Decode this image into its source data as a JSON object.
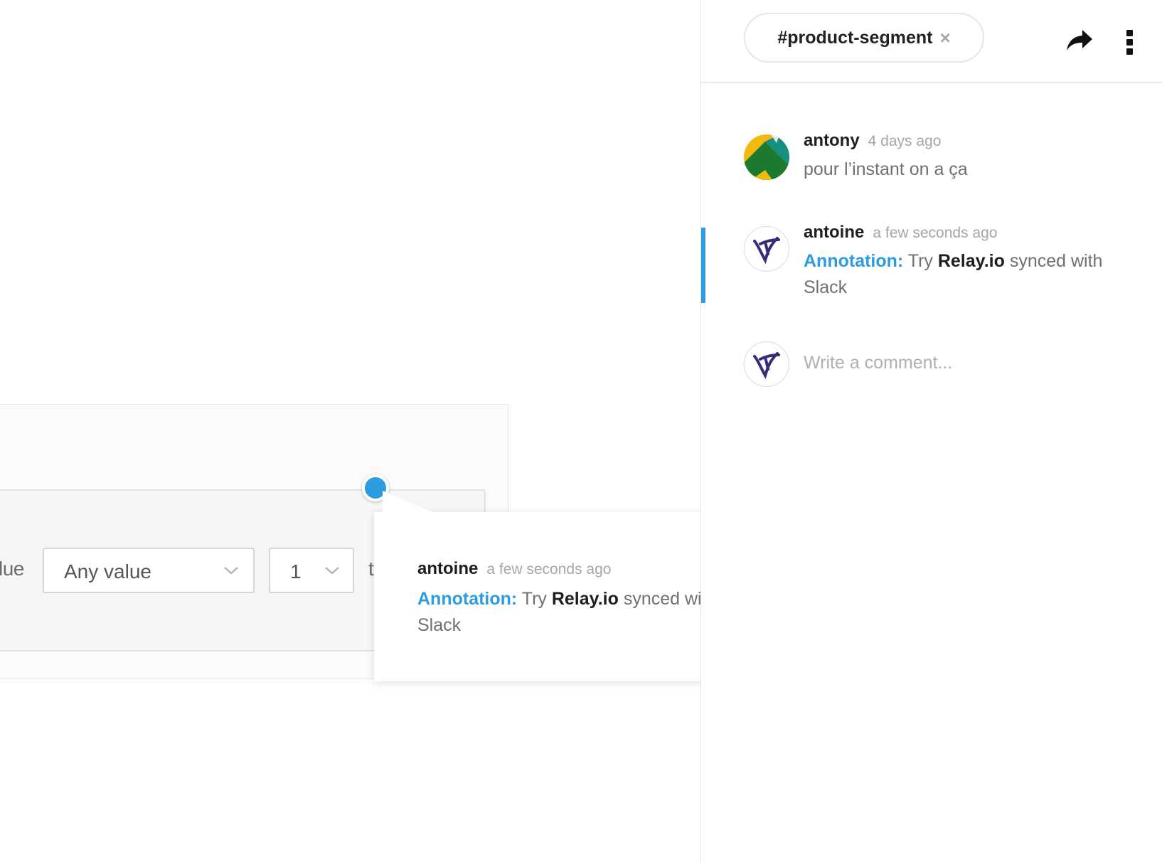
{
  "canvas": {
    "row_label": "lue",
    "select_any": {
      "value": "Any value"
    },
    "select_one": {
      "value": "1"
    },
    "row_trail": "t"
  },
  "popover": {
    "author": "antoine",
    "time": "a few seconds ago",
    "annotation_label": "Annotation:",
    "text_before": " Try ",
    "text_strong": "Relay.io",
    "text_after": " synced with Slack"
  },
  "header": {
    "channel_tag": "#product-segment",
    "close_glyph": "×",
    "share_icon": "share-arrow-icon",
    "more_icon": "more-vertical-icon"
  },
  "comments": [
    {
      "author": "antony",
      "time": "4 days ago",
      "text": "pour l’instant on a ça"
    },
    {
      "author": "antoine",
      "time": "a few seconds ago",
      "annotation_label": "Annotation:",
      "text_before": " Try ",
      "text_strong": "Relay.io",
      "text_after": " synced with Slack"
    }
  ],
  "composer": {
    "placeholder": "Write a comment..."
  },
  "colors": {
    "accent": "#2d9be0",
    "muted_text": "#707070",
    "time_text": "#a6a6a6"
  }
}
